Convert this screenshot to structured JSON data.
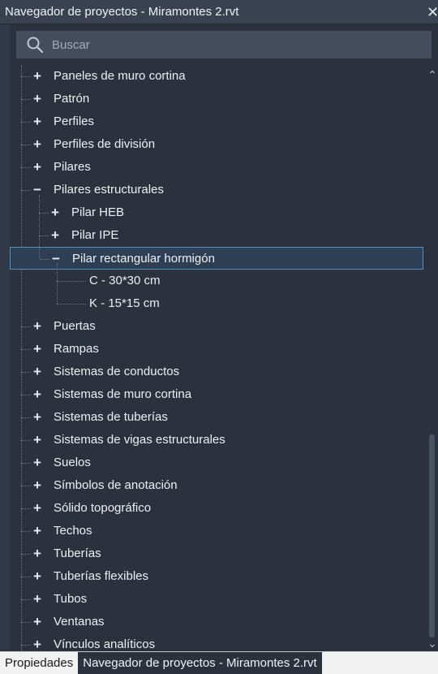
{
  "window": {
    "title": "Navegador de proyectos - Miramontes 2.rvt",
    "close_glyph": "✕"
  },
  "search": {
    "placeholder": "Buscar",
    "icon": "search-icon"
  },
  "tree": {
    "rows": [
      {
        "label": "Paneles de muro cortina",
        "toggle": "+",
        "level": 1
      },
      {
        "label": "Patrón",
        "toggle": "+",
        "level": 1
      },
      {
        "label": "Perfiles",
        "toggle": "+",
        "level": 1
      },
      {
        "label": "Perfiles de división",
        "toggle": "+",
        "level": 1
      },
      {
        "label": "Pilares",
        "toggle": "+",
        "level": 1
      },
      {
        "label": "Pilares estructurales",
        "toggle": "−",
        "level": 1
      },
      {
        "label": "Pilar HEB",
        "toggle": "+",
        "level": 2
      },
      {
        "label": "Pilar IPE",
        "toggle": "+",
        "level": 2
      },
      {
        "label": "Pilar rectangular hormigón",
        "toggle": "−",
        "level": 2,
        "selected": true
      },
      {
        "label": "C - 30*30 cm",
        "toggle": "",
        "level": 3
      },
      {
        "label": "K - 15*15 cm",
        "toggle": "",
        "level": 3
      },
      {
        "label": "Puertas",
        "toggle": "+",
        "level": 1
      },
      {
        "label": "Rampas",
        "toggle": "+",
        "level": 1
      },
      {
        "label": "Sistemas de conductos",
        "toggle": "+",
        "level": 1
      },
      {
        "label": "Sistemas de muro cortina",
        "toggle": "+",
        "level": 1
      },
      {
        "label": "Sistemas de tuberías",
        "toggle": "+",
        "level": 1
      },
      {
        "label": "Sistemas de vigas estructurales",
        "toggle": "+",
        "level": 1
      },
      {
        "label": "Suelos",
        "toggle": "+",
        "level": 1
      },
      {
        "label": "Símbolos de anotación",
        "toggle": "+",
        "level": 1
      },
      {
        "label": "Sólido topográfico",
        "toggle": "+",
        "level": 1
      },
      {
        "label": "Techos",
        "toggle": "+",
        "level": 1
      },
      {
        "label": "Tuberías",
        "toggle": "+",
        "level": 1
      },
      {
        "label": "Tuberías flexibles",
        "toggle": "+",
        "level": 1
      },
      {
        "label": "Tubos",
        "toggle": "+",
        "level": 1
      },
      {
        "label": "Ventanas",
        "toggle": "+",
        "level": 1
      },
      {
        "label": "Vínculos analíticos",
        "toggle": "+",
        "level": 1
      }
    ]
  },
  "scrollbar": {
    "up_glyph": "⌃",
    "down_glyph": "⌄"
  },
  "tabs": [
    {
      "label": "Propiedades",
      "active": false
    },
    {
      "label": "Navegador de proyectos - Miramontes 2.rvt",
      "active": true
    }
  ],
  "colors": {
    "panel_bg": "#2b313d",
    "selection_border": "#4e92c7",
    "selection_bg": "#2f3f53"
  }
}
